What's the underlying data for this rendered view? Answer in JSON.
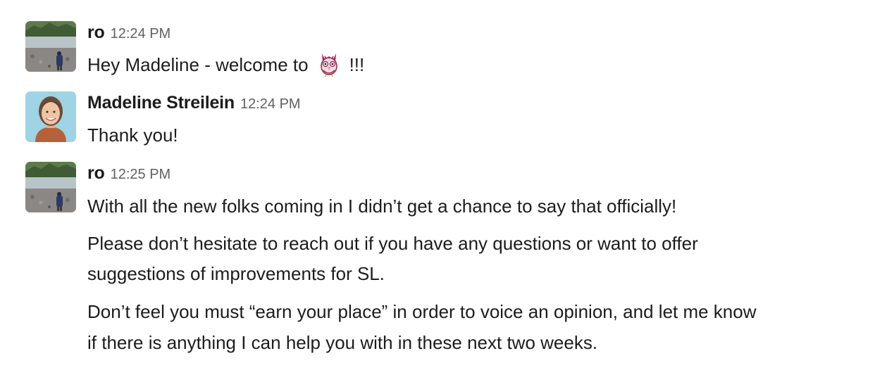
{
  "messages": [
    {
      "sender": "ro",
      "time": "12:24 PM",
      "text_before_emoji": "Hey Madeline - welcome to",
      "emoji": "owl-emoji",
      "text_after_emoji": "!!!"
    },
    {
      "sender": "Madeline Streilein",
      "time": "12:24 PM",
      "text": "Thank you!"
    },
    {
      "sender": "ro",
      "time": "12:25 PM",
      "paragraphs": [
        "With all the new folks coming in I didn’t get a chance to say that officially!",
        "Please don’t hesitate to reach out if you have any questions or want to offer",
        "suggestions of improvements for SL.",
        "Don’t feel you must “earn your place” in order to voice an opinion, and let me know",
        "if there is anything I can help you with in these next two weeks."
      ]
    }
  ],
  "colors": {
    "text": "#1d1c1d",
    "timestamp": "#616061",
    "background": "#ffffff"
  }
}
